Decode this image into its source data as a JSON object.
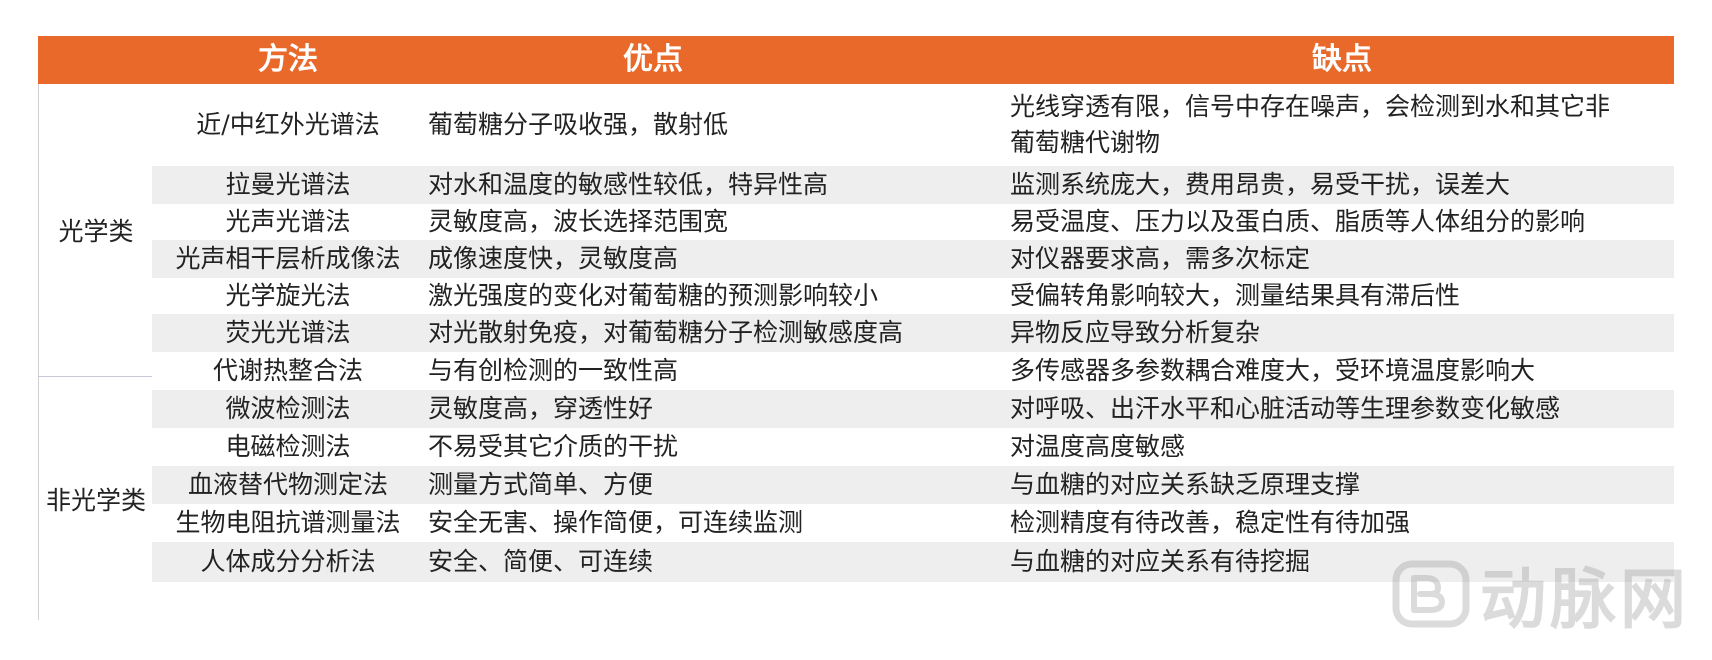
{
  "header": {
    "method": "方法",
    "pros": "优点",
    "cons": "缺点"
  },
  "categories": {
    "optical": "光学类",
    "non_optical": "非光学类"
  },
  "rows": [
    {
      "method": "近/中红外光谱法",
      "pros": "葡萄糖分子吸收强，散射低",
      "cons": "光线穿透有限，信号中存在噪声，会检测到水和其它非葡萄糖代谢物"
    },
    {
      "method": "拉曼光谱法",
      "pros": "对水和温度的敏感性较低，特异性高",
      "cons": "监测系统庞大，费用昂贵，易受干扰，误差大"
    },
    {
      "method": "光声光谱法",
      "pros": "灵敏度高，波长选择范围宽",
      "cons": "易受温度、压力以及蛋白质、脂质等人体组分的影响"
    },
    {
      "method": "光声相干层析成像法",
      "pros": "成像速度快，灵敏度高",
      "cons": "对仪器要求高，需多次标定"
    },
    {
      "method": "光学旋光法",
      "pros": "激光强度的变化对葡萄糖的预测影响较小",
      "cons": "受偏转角影响较大，测量结果具有滞后性"
    },
    {
      "method": "荧光光谱法",
      "pros": "对光散射免疫，对葡萄糖分子检测敏感度高",
      "cons": "异物反应导致分析复杂"
    },
    {
      "method": "代谢热整合法",
      "pros": "与有创检测的一致性高",
      "cons": "多传感器多参数耦合难度大，受环境温度影响大"
    },
    {
      "method": "微波检测法",
      "pros": "灵敏度高，穿透性好",
      "cons": "对呼吸、出汗水平和心脏活动等生理参数变化敏感"
    },
    {
      "method": "电磁检测法",
      "pros": "不易受其它介质的干扰",
      "cons": "对温度高度敏感"
    },
    {
      "method": "血液替代物测定法",
      "pros": "测量方式简单、方便",
      "cons": "与血糖的对应关系缺乏原理支撑"
    },
    {
      "method": "生物电阻抗谱测量法",
      "pros": "安全无害、操作简便，可连续监测",
      "cons": "检测精度有待改善，稳定性有待加强"
    },
    {
      "method": "人体成分分析法",
      "pros": "安全、简便、可连续",
      "cons": "与血糖的对应关系有待挖掘"
    }
  ],
  "watermark": {
    "text": "动脉网",
    "logo_icon": "vb-logo-icon"
  },
  "colors": {
    "header_bg": "#e8692a",
    "header_text": "#ffffff",
    "shaded_row": "#eeeeee"
  }
}
